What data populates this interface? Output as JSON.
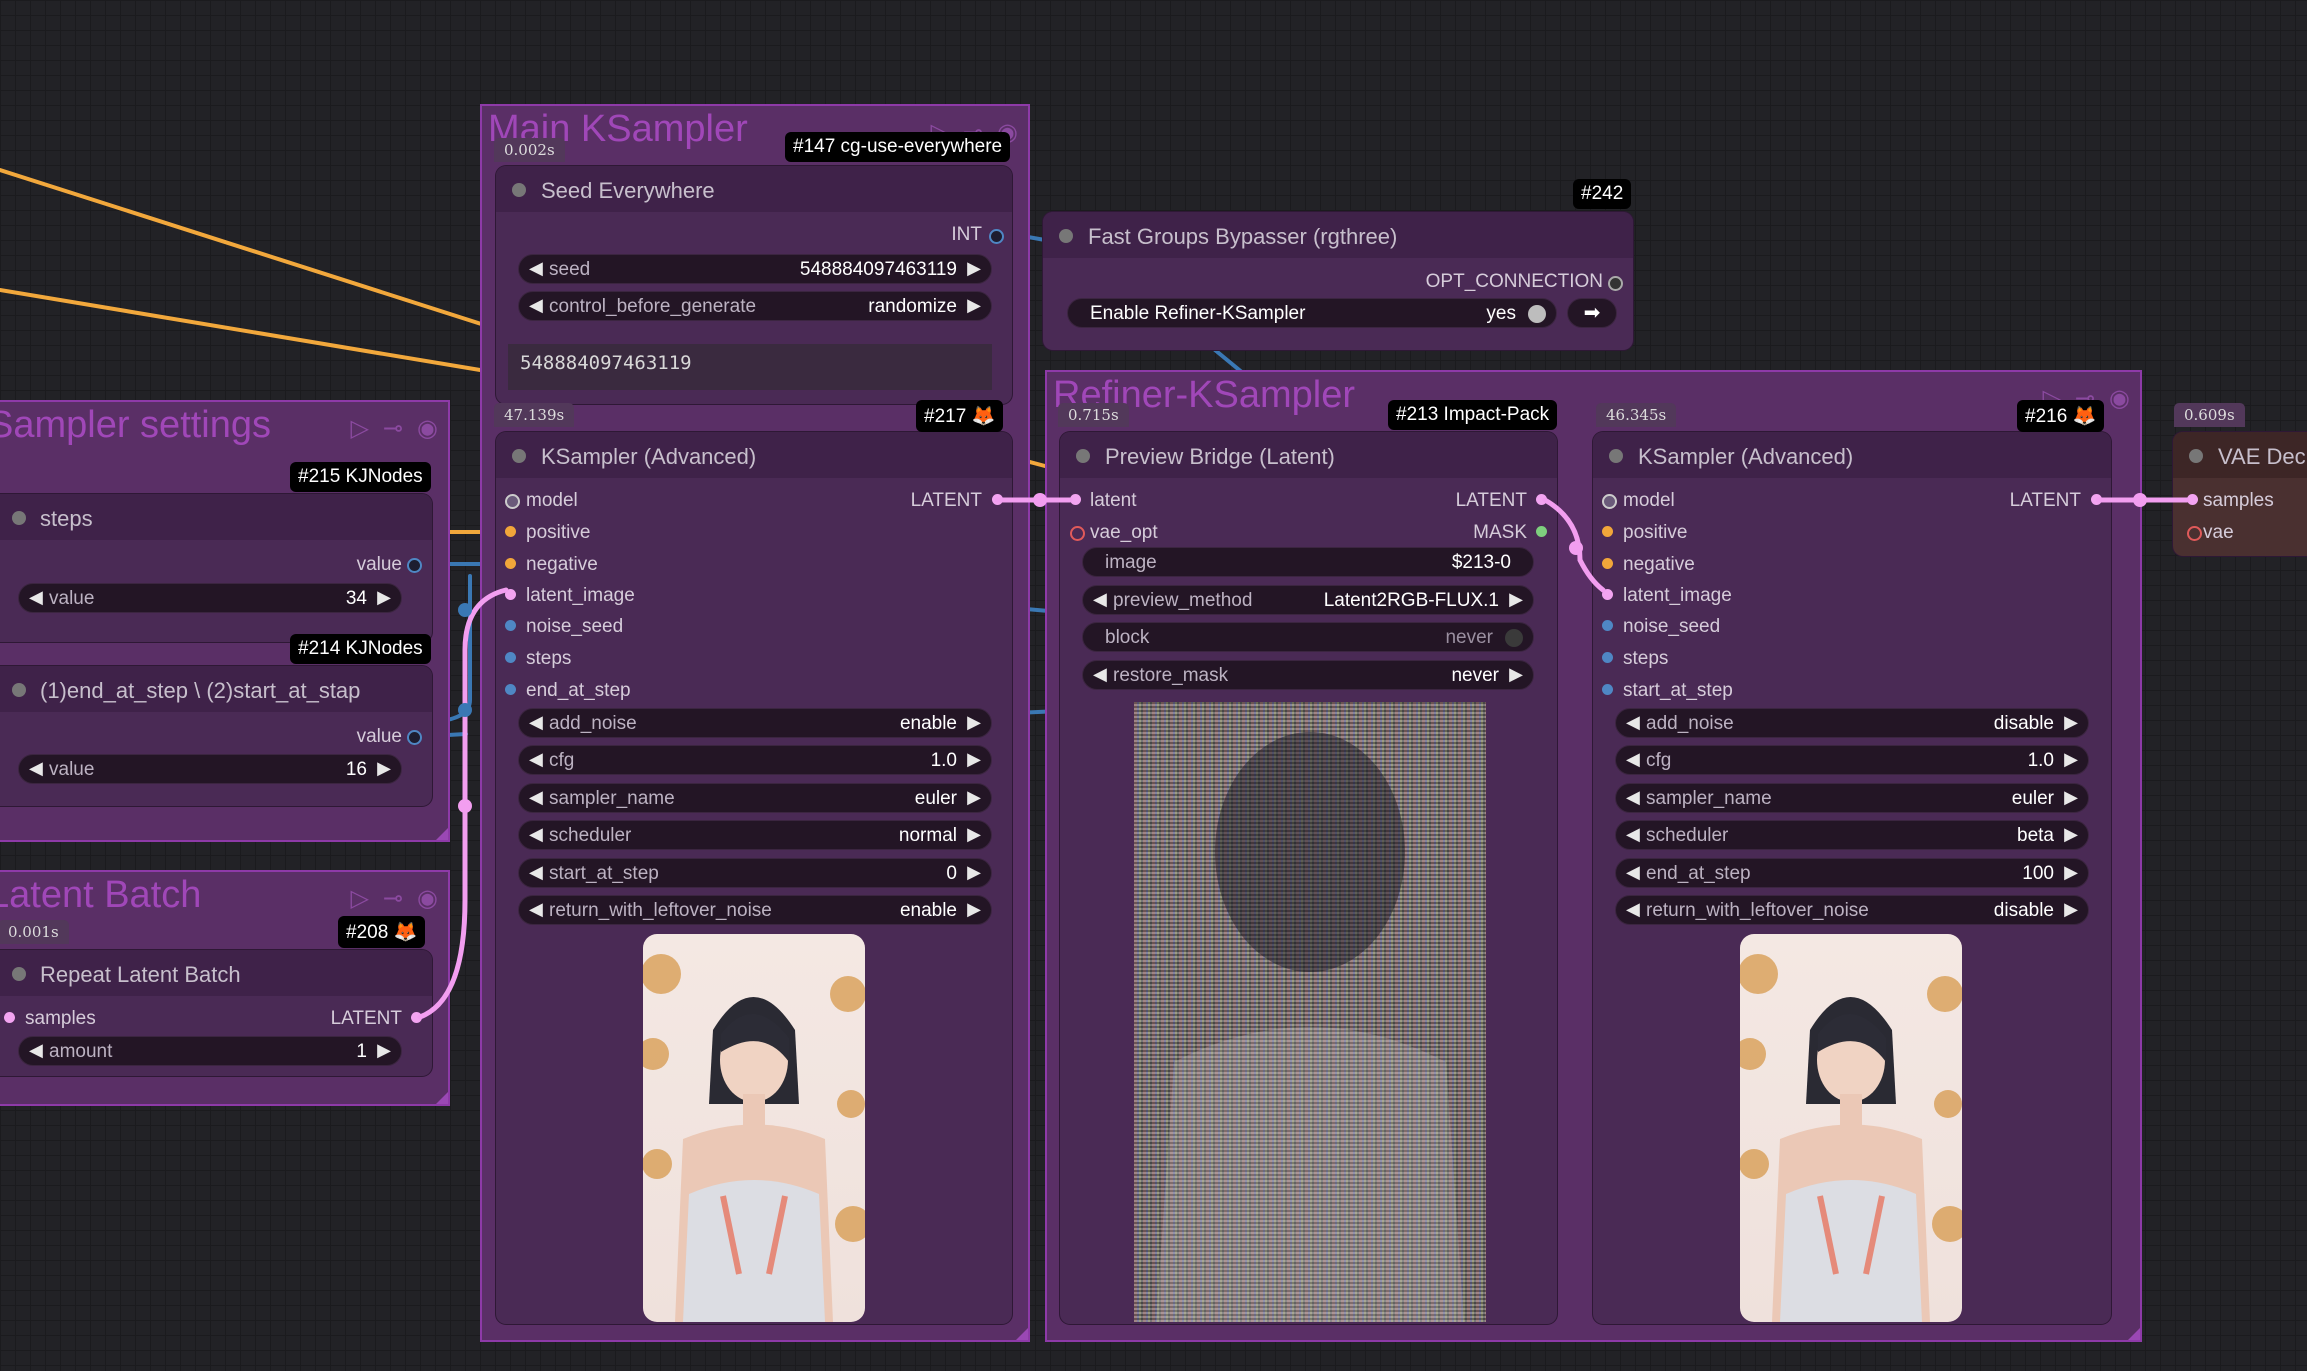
{
  "groups": {
    "main_ksampler": {
      "title": "Main KSampler"
    },
    "refiner_ksampler": {
      "title": "Refiner-KSampler"
    },
    "sampler_settings": {
      "title": "Sampler settings"
    },
    "latent_batch": {
      "title": "Latent Batch"
    }
  },
  "badges": {
    "b147": "#147 cg-use-everywhere",
    "b242": "#242",
    "b217": "#217 🦊",
    "b213": "#213 Impact-Pack",
    "b216": "#216 🦊",
    "b215": "#215 KJNodes",
    "b214": "#214 KJNodes",
    "b208": "#208 🦊"
  },
  "timings": {
    "seed": "0.002s",
    "ksampler_main": "47.139s",
    "preview_bridge": "0.715s",
    "ksampler_refiner": "46.345s",
    "vae_decode": "0.609s",
    "latent_batch": "0.001s"
  },
  "seed_everywhere": {
    "title": "Seed Everywhere",
    "output": "INT",
    "seed_label": "seed",
    "seed_value": "548884097463119",
    "control_label": "control_before_generate",
    "control_value": "randomize",
    "seed_text": "548884097463119"
  },
  "fast_groups": {
    "title": "Fast Groups Bypasser (rgthree)",
    "output": "OPT_CONNECTION",
    "toggle_label": "Enable Refiner-KSampler",
    "toggle_value": "yes"
  },
  "ksampler_main": {
    "title": "KSampler (Advanced)",
    "inputs": [
      "model",
      "positive",
      "negative",
      "latent_image",
      "noise_seed",
      "steps",
      "end_at_step"
    ],
    "output": "LATENT",
    "widgets": [
      {
        "name": "add_noise",
        "value": "enable"
      },
      {
        "name": "cfg",
        "value": "1.0"
      },
      {
        "name": "sampler_name",
        "value": "euler"
      },
      {
        "name": "scheduler",
        "value": "normal"
      },
      {
        "name": "start_at_step",
        "value": "0"
      },
      {
        "name": "return_with_leftover_noise",
        "value": "enable"
      }
    ]
  },
  "preview_bridge": {
    "title": "Preview Bridge (Latent)",
    "inputs": [
      "latent",
      "vae_opt"
    ],
    "outputs": [
      "LATENT",
      "MASK"
    ],
    "image_label": "image",
    "image_value": "$213-0",
    "preview_method_label": "preview_method",
    "preview_method_value": "Latent2RGB-FLUX.1",
    "block_label": "block",
    "block_value": "never",
    "restore_mask_label": "restore_mask",
    "restore_mask_value": "never"
  },
  "ksampler_refiner": {
    "title": "KSampler (Advanced)",
    "inputs": [
      "model",
      "positive",
      "negative",
      "latent_image",
      "noise_seed",
      "steps",
      "start_at_step"
    ],
    "output": "LATENT",
    "widgets": [
      {
        "name": "add_noise",
        "value": "disable"
      },
      {
        "name": "cfg",
        "value": "1.0"
      },
      {
        "name": "sampler_name",
        "value": "euler"
      },
      {
        "name": "scheduler",
        "value": "beta"
      },
      {
        "name": "end_at_step",
        "value": "100"
      },
      {
        "name": "return_with_leftover_noise",
        "value": "disable"
      }
    ]
  },
  "vae_decode": {
    "title": "VAE Dec",
    "inputs": [
      "samples",
      "vae"
    ]
  },
  "steps_node": {
    "title": "steps",
    "output": "value",
    "widget_label": "value",
    "widget_value": "34"
  },
  "end_step_node": {
    "title": "(1)end_at_step \\ (2)start_at_stap",
    "output": "value",
    "widget_label": "value",
    "widget_value": "16"
  },
  "repeat_latent": {
    "title": "Repeat Latent Batch",
    "input": "samples",
    "output": "LATENT",
    "widget_label": "amount",
    "widget_value": "1"
  },
  "icons": {
    "group_play": "play-icon",
    "group_link": "link-icon",
    "group_eye": "eye-icon",
    "fox": "fox-icon",
    "arrow_right": "arrow-right-icon"
  },
  "colors": {
    "group_fill": "#5a2f66",
    "group_border": "#8e3aa8",
    "wire_orange": "#f2a83c",
    "wire_blue": "#3a78b4",
    "wire_pink": "#f29ef0",
    "slot_pink": "#f3a4f1",
    "slot_orange": "#f1a63a",
    "slot_blue": "#4f87c4"
  }
}
